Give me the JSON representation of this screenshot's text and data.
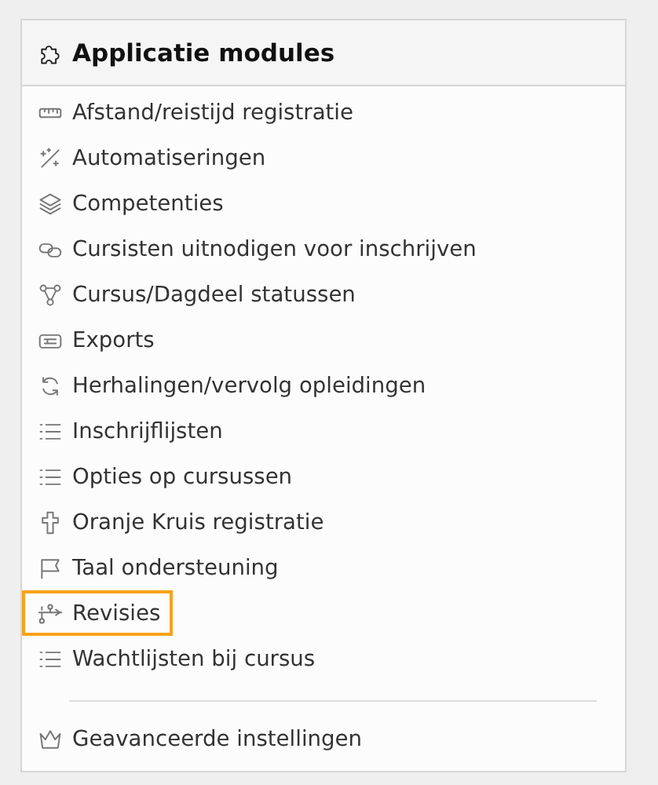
{
  "panel": {
    "title": "Applicatie modules",
    "items": [
      {
        "label": "Afstand/reistijd registratie",
        "highlighted": false
      },
      {
        "label": "Automatiseringen",
        "highlighted": false
      },
      {
        "label": "Competenties",
        "highlighted": false
      },
      {
        "label": "Cursisten uitnodigen voor inschrijven",
        "highlighted": false
      },
      {
        "label": "Cursus/Dagdeel statussen",
        "highlighted": false
      },
      {
        "label": "Exports",
        "highlighted": false
      },
      {
        "label": "Herhalingen/vervolg opleidingen",
        "highlighted": false
      },
      {
        "label": "Inschrijflijsten",
        "highlighted": false
      },
      {
        "label": "Opties op cursussen",
        "highlighted": false
      },
      {
        "label": "Oranje Kruis registratie",
        "highlighted": false
      },
      {
        "label": "Taal ondersteuning",
        "highlighted": false
      },
      {
        "label": "Revisies",
        "highlighted": true
      },
      {
        "label": "Wachtlijsten bij cursus",
        "highlighted": false
      }
    ],
    "footer_items": [
      {
        "label": "Geavanceerde instellingen",
        "highlighted": false
      }
    ]
  }
}
